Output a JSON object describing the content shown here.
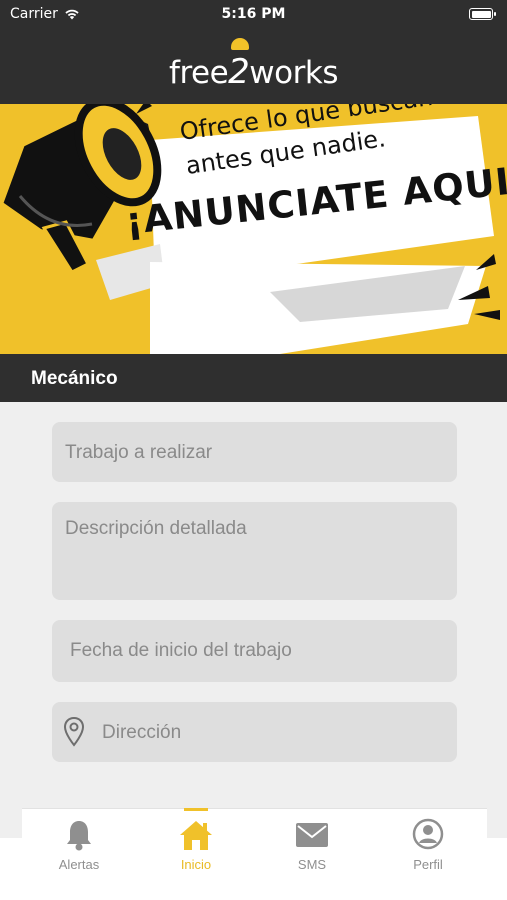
{
  "status_bar": {
    "carrier": "Carrier",
    "time": "5:16 PM"
  },
  "header": {
    "logo_part1": "free",
    "logo_part2": "2",
    "logo_part3": "works"
  },
  "banner": {
    "line1": "Ofrece lo que buscan",
    "line2": "antes que nadie.",
    "line3": "¡ANUNCIATE AQUI!"
  },
  "section": {
    "title": "Mecánico"
  },
  "form": {
    "trabajo_placeholder": "Trabajo a realizar",
    "descripcion_placeholder": "Descripción detallada",
    "fecha_placeholder": "Fecha de inicio del trabajo",
    "direccion_placeholder": "Dirección"
  },
  "tabs": [
    {
      "label": "Alertas",
      "icon": "bell-icon",
      "active": false
    },
    {
      "label": "Inicio",
      "icon": "home-icon",
      "active": true
    },
    {
      "label": "SMS",
      "icon": "envelope-icon",
      "active": false
    },
    {
      "label": "Perfil",
      "icon": "user-circle-icon",
      "active": false
    }
  ],
  "colors": {
    "accent": "#f0c12a",
    "dark": "#2f2f2f",
    "field": "#dedede",
    "background": "#efefef"
  }
}
